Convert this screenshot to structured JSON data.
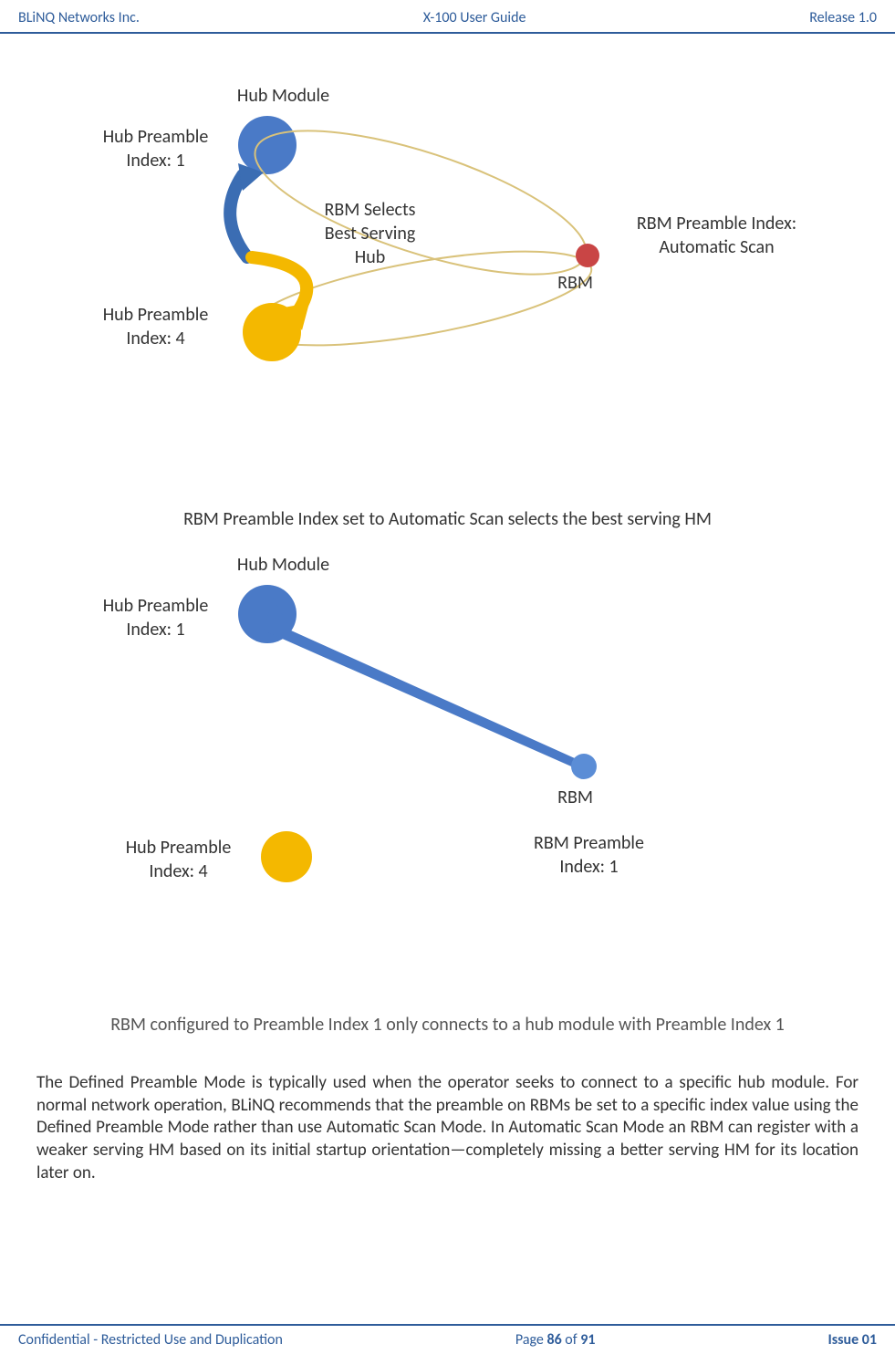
{
  "header": {
    "left": "BLiNQ Networks Inc.",
    "center": "X-100 User Guide",
    "right": "Release 1.0"
  },
  "figure1": {
    "hub_module": "Hub Module",
    "hub_preamble_1": "Hub Preamble\nIndex: 1",
    "hub_preamble_4": "Hub Preamble\nIndex: 4",
    "rbm_selects": "RBM Selects\nBest Serving\nHub",
    "rbm": "RBM",
    "rbm_preamble": "RBM Preamble Index:\nAutomatic Scan",
    "caption": "RBM Preamble Index set to Automatic Scan selects  the best serving HM"
  },
  "figure2": {
    "hub_module": "Hub Module",
    "hub_preamble_1": "Hub Preamble\nIndex: 1",
    "hub_preamble_4": "Hub Preamble\nIndex: 4",
    "rbm": "RBM",
    "rbm_preamble": "RBM Preamble\nIndex: 1",
    "caption": "RBM configured to Preamble Index 1 only connects to a hub module with Preamble Index 1"
  },
  "body": {
    "paragraph": "The Defined Preamble Mode is typically used when the operator seeks to connect to a specific hub module. For normal network operation, BLiNQ recommends that the preamble on RBMs be set to a specific index value using the Defined Preamble Mode rather than use Automatic Scan Mode. In Automatic Scan Mode an RBM can register with a weaker serving HM based on its initial startup orientation—completely missing a better serving HM for its location later on."
  },
  "footer": {
    "left": "Confidential - Restricted Use and Duplication",
    "center_prefix": "Page ",
    "page_current": "86",
    "center_mid": " of ",
    "page_total": "91",
    "right": "Issue 01"
  }
}
